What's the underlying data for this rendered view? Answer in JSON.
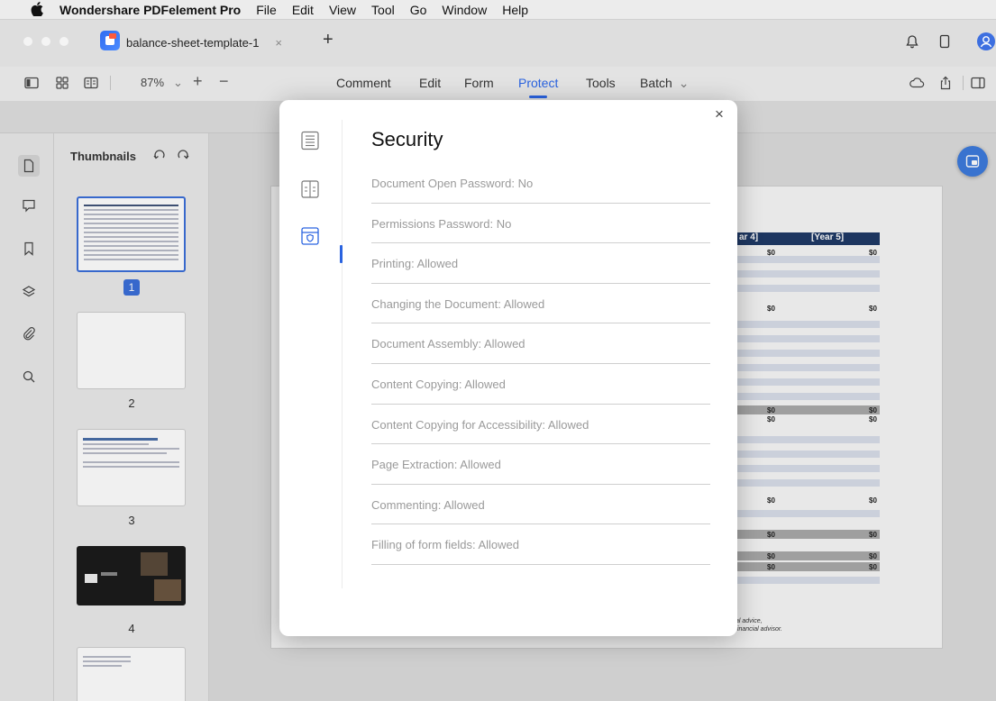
{
  "menubar": {
    "app_name": "Wondershare PDFelement Pro",
    "items": [
      "File",
      "Edit",
      "View",
      "Tool",
      "Go",
      "Window",
      "Help"
    ]
  },
  "tabbar": {
    "doc_tab": "balance-sheet-template-1",
    "close_glyph": "×",
    "new_tab_glyph": "+"
  },
  "toolbar": {
    "zoom": "87%",
    "zoom_in": "+",
    "zoom_out": "−",
    "tabs": [
      "Comment",
      "Edit",
      "Form",
      "Protect",
      "Tools",
      "Batch"
    ],
    "active_tab": "Protect",
    "batch_chevron": "⌄"
  },
  "thumbnails": {
    "title": "Thumbnails",
    "pages": [
      "1",
      "2",
      "3",
      "4"
    ],
    "selected": "1"
  },
  "document": {
    "headers": [
      "ar 4]",
      "[Year 5]"
    ],
    "value": "$0",
    "footnote_1": "al advice,",
    "footnote_2": "financial advisor."
  },
  "modal": {
    "title": "Security",
    "close_glyph": "×",
    "items": [
      "Document Open Password: No",
      "Permissions Password: No",
      "Printing: Allowed",
      "Changing the Document: Allowed",
      "Document Assembly: Allowed",
      "Content Copying: Allowed",
      "Content Copying for Accessibility: Allowed",
      "Page Extraction: Allowed",
      "Commenting: Allowed",
      "Filling of form fields: Allowed"
    ]
  },
  "colors": {
    "accent": "#2a63e0",
    "sheet_header": "#1f3a66"
  }
}
